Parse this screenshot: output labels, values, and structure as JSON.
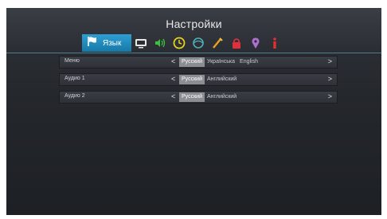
{
  "header": {
    "title": "Настройки"
  },
  "tabs": {
    "active_label": "Язык",
    "items": [
      "display-icon",
      "audio-icon",
      "clock-icon",
      "network-icon",
      "tools-icon",
      "lock-icon",
      "location-icon",
      "info-icon"
    ]
  },
  "rows": [
    {
      "label": "Меню",
      "options": [
        "Русский",
        "Українська",
        "English"
      ],
      "selected": "Русский"
    },
    {
      "label": "Аудио 1",
      "options": [
        "Русский",
        "Английский"
      ],
      "selected": "Русский"
    },
    {
      "label": "Аудио 2",
      "options": [
        "Русский",
        "Английский"
      ],
      "selected": "Русский"
    }
  ],
  "arrows": {
    "left": "<",
    "right": ">"
  },
  "colors": {
    "accent": "#1e8bc3",
    "selected_bg": "#8a8d92",
    "background": "#24272c"
  }
}
